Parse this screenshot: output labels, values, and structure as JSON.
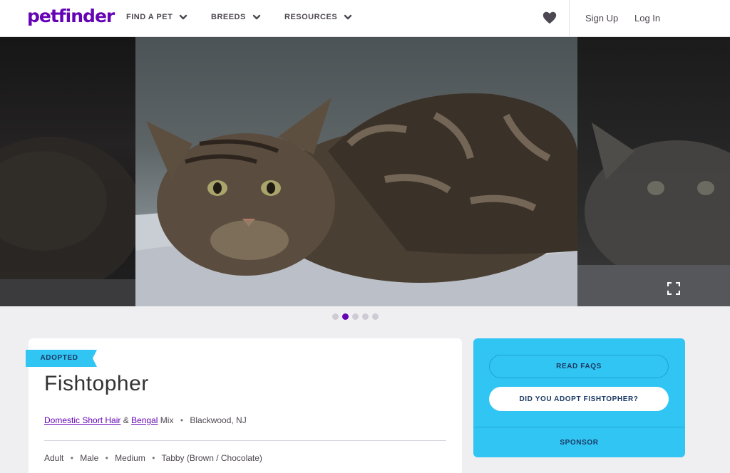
{
  "header": {
    "logo": "petfinder",
    "nav": [
      {
        "label": "FIND A PET"
      },
      {
        "label": "BREEDS"
      },
      {
        "label": "RESOURCES"
      }
    ],
    "sign_up": "Sign Up",
    "log_in": "Log In"
  },
  "carousel": {
    "slide_count": 5,
    "active_slide": 2
  },
  "pet": {
    "status_badge": "ADOPTED",
    "name": "Fishtopher",
    "breed_primary": "Domestic Short Hair",
    "breed_joiner": "&",
    "breed_secondary": "Bengal",
    "breed_suffix": "Mix",
    "location": "Blackwood, NJ",
    "age": "Adult",
    "sex": "Male",
    "size": "Medium",
    "color": "Tabby (Brown / Chocolate)"
  },
  "actions": {
    "read_faqs": "READ FAQS",
    "did_you_adopt": "DID YOU ADOPT FISHTOPHER?",
    "sponsor": "SPONSOR"
  },
  "colors": {
    "brand_purple": "#6504b5",
    "panel_blue": "#31c5f4",
    "badge_blue": "#31c5f4",
    "page_bg": "#efeef1"
  },
  "icons": {
    "heart": "heart-icon",
    "chevron": "chevron-down-icon",
    "expand": "expand-icon"
  }
}
